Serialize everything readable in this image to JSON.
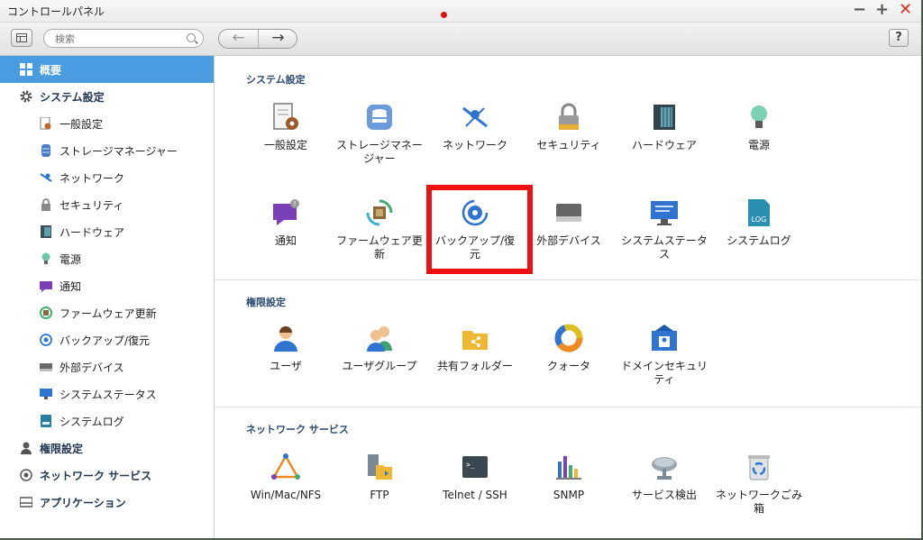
{
  "window": {
    "title": "コントロールパネル",
    "buttons": {
      "minimize": "−",
      "maximize": "+",
      "close": "✕"
    }
  },
  "toolbar": {
    "search_placeholder": "検索",
    "back_label": "←",
    "forward_label": "→",
    "help_label": "?"
  },
  "sidebar": {
    "overview": "概要",
    "system": "システム設定",
    "system_items": [
      "一般設定",
      "ストレージマネージャー",
      "ネットワーク",
      "セキュリティ",
      "ハードウェア",
      "電源",
      "通知",
      "ファームウェア更新",
      "バックアップ/復元",
      "外部デバイス",
      "システムステータス",
      "システムログ"
    ],
    "privilege": "権限設定",
    "network_services": "ネットワーク サービス",
    "applications": "アプリケーション"
  },
  "main": {
    "system_title": "システム設定",
    "system_row1": [
      "一般設定",
      "ストレージマネージャー",
      "ネットワーク",
      "セキュリティ",
      "ハードウェア",
      "電源"
    ],
    "system_row2": [
      "通知",
      "ファームウェア更新",
      "バックアップ/復元",
      "外部デバイス",
      "システムステータス",
      "システムログ"
    ],
    "privilege_title": "権限設定",
    "privilege_items": [
      "ユーザ",
      "ユーザグループ",
      "共有フォルダー",
      "クォータ",
      "ドメインセキュリティ"
    ],
    "network_title": "ネットワーク サービス",
    "network_items": [
      "Win/Mac/NFS",
      "FTP",
      "Telnet / SSH",
      "SNMP",
      "サービス検出",
      "ネットワークごみ箱"
    ]
  },
  "colors": {
    "sidebar_active": "#4a9ce0",
    "highlight_box": "#ee1111",
    "section_title": "#2a4a70"
  }
}
